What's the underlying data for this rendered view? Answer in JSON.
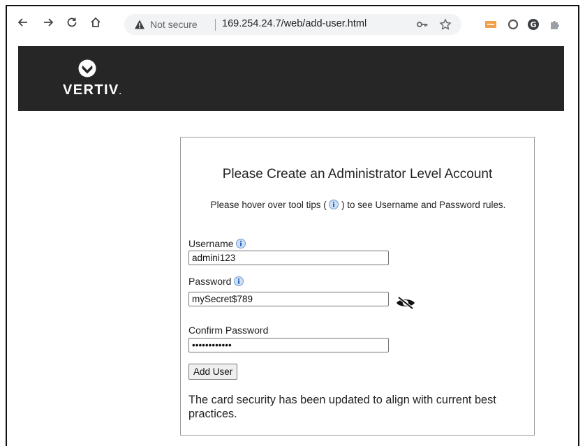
{
  "browser": {
    "nav": {
      "back_icon": "arrow-left-icon",
      "forward_icon": "arrow-right-icon",
      "reload_icon": "reload-icon",
      "home_icon": "home-icon"
    },
    "security_label": "Not secure",
    "url": "169.254.24.7/web/add-user.html",
    "omnibox_icons": [
      "key-icon",
      "star-icon"
    ],
    "extensions": [
      "xml-extension-icon",
      "circle-extension-icon",
      "g-extension-icon",
      "puzzle-extension-icon"
    ]
  },
  "header": {
    "brand": "VERTIV",
    "brand_suffix": ".",
    "bg_color": "#262626"
  },
  "form": {
    "title": "Please Create an Administrator Level Account",
    "hint_before": "Please hover over tool tips (",
    "hint_after": ") to see Username and Password rules.",
    "username_label": "Username",
    "username_value": "admini123",
    "password_label": "Password",
    "password_value": "mySecret$789",
    "confirm_label": "Confirm Password",
    "confirm_value": "mySecret$789",
    "submit_label": "Add User",
    "notice": "The card security has been updated to align with current best practices."
  }
}
